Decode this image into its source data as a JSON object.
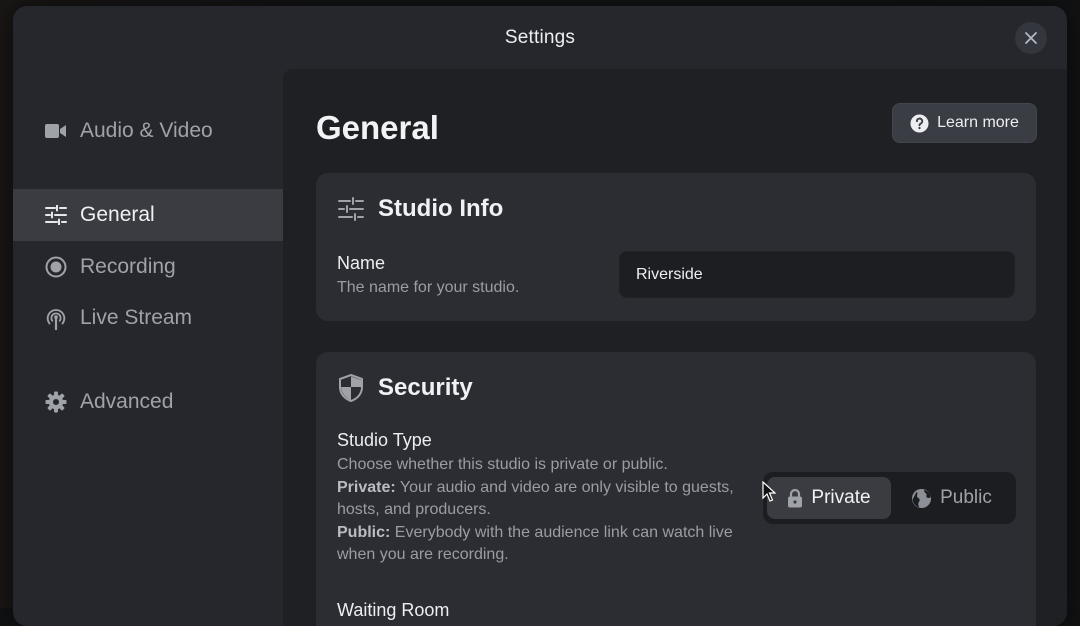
{
  "modal": {
    "title": "Settings"
  },
  "sidebar": {
    "items": [
      {
        "label": "Audio & Video",
        "icon": "video-camera-icon",
        "active": false
      },
      {
        "label": "General",
        "icon": "sliders-icon",
        "active": true
      },
      {
        "label": "Recording",
        "icon": "record-icon",
        "active": false
      },
      {
        "label": "Live Stream",
        "icon": "broadcast-icon",
        "active": false
      },
      {
        "label": "Advanced",
        "icon": "gear-icon",
        "active": false
      }
    ]
  },
  "main": {
    "title": "General",
    "learn_more": "Learn more",
    "studio_info": {
      "title": "Studio Info",
      "name_label": "Name",
      "name_desc": "The name for your studio.",
      "name_value": "Riverside"
    },
    "security": {
      "title": "Security",
      "studio_type_label": "Studio Type",
      "studio_type_desc": "Choose whether this studio is private or public.",
      "private_title": "Private:",
      "private_desc": " Your audio and video are only visible to guests, hosts, and producers.",
      "public_title": "Public:",
      "public_desc": " Everybody with the audience link can watch live when you are recording.",
      "options": {
        "private": "Private",
        "public": "Public",
        "selected": "Private"
      },
      "next_label": "Waiting Room"
    }
  },
  "colors": {
    "modal_bg": "#25272c",
    "content_bg": "#1e2024",
    "card_bg": "#2b2d32",
    "active_item_bg": "#3a3c42"
  }
}
